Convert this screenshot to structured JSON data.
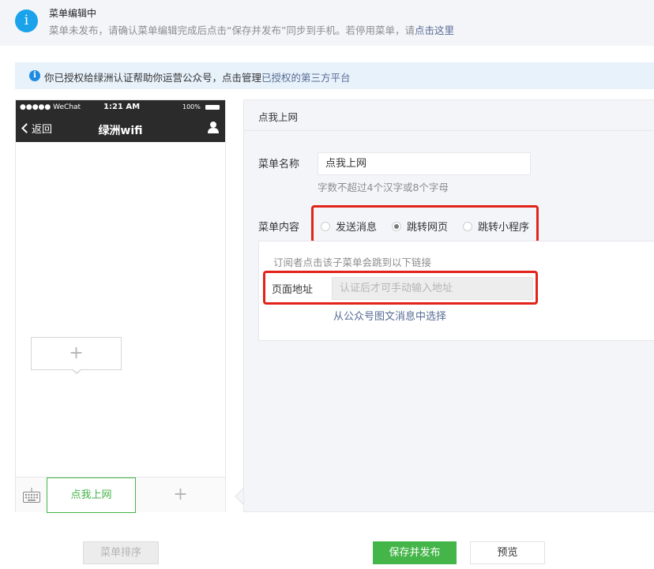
{
  "notice": {
    "title": "菜单编辑中",
    "desc_prefix": "菜单未发布，请确认菜单编辑完成后点击“保存并发布”同步到手机。若停用菜单，请",
    "desc_link": "点击这里"
  },
  "auth": {
    "text_prefix": "你已授权给绿洲认证帮助你运营公众号，点击管理",
    "text_link": "已授权的第三方平台"
  },
  "phone": {
    "carrier": "●●●●● WeChat",
    "time": "1:21 AM",
    "battery": "100%",
    "back_label": "返回",
    "title": "绿洲wifi",
    "sub_add": "+",
    "menu_item_label": "点我上网",
    "main_add": "+"
  },
  "editor": {
    "title": "点我上网",
    "name_label": "菜单名称",
    "name_value": "点我上网",
    "name_hint": "字数不超过4个汉字或8个字母",
    "content_label": "菜单内容",
    "options": [
      "发送消息",
      "跳转网页",
      "跳转小程序"
    ],
    "selected_option": "跳转网页",
    "link_intro": "订阅者点击该子菜单会跳到以下链接",
    "url_label": "页面地址",
    "url_placeholder": "认证后才可手动输入地址",
    "pick_link": "从公众号图文消息中选择"
  },
  "footer": {
    "sort_label": "菜单排序",
    "save_label": "保存并发布",
    "preview_label": "预览"
  },
  "colors": {
    "accent_green": "#44b549",
    "link_blue": "#576b95",
    "info_blue": "#1aa3ea",
    "highlight_red": "#e2231a"
  }
}
